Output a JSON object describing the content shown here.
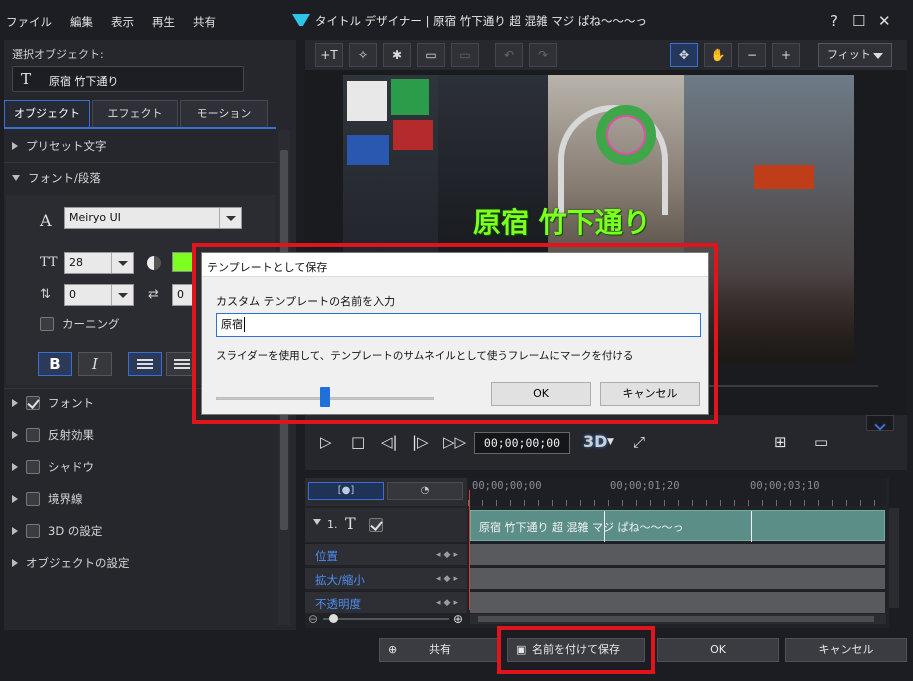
{
  "window": {
    "menu": [
      "ファイル",
      "編集",
      "表示",
      "再生",
      "共有"
    ],
    "title": "タイトル デザイナー | 原宿 竹下通り 超 混雑 マジ ぱね〜〜〜っ",
    "help": "?",
    "maximize": "☐",
    "close": "✕"
  },
  "left_panel": {
    "selected_label": "選択オブジェクト:",
    "selected_icon": "T",
    "selected_value": "原宿 竹下通り",
    "tabs": [
      "オブジェクト",
      "エフェクト",
      "モーション"
    ],
    "sections": {
      "preset": "プリセット文字",
      "font_para": "フォント/段落",
      "font": "フォント",
      "reflection": "反射効果",
      "shadow": "シャドウ",
      "border": "境界線",
      "threed": "3D の設定",
      "object_settings": "オブジェクトの設定"
    },
    "font_name": "Meiryo UI",
    "font_size": "28",
    "line_spacing": "0",
    "letter_spacing": "0",
    "kerning": "カーニング",
    "bold": "B",
    "italic": "I",
    "text_color": "#7dff1f",
    "font_icon": "A",
    "size_icon": "TT",
    "checked_font": true
  },
  "toolbar": {
    "fit": "フィット"
  },
  "preview": {
    "overlay_text": "原宿 竹下通り",
    "timecode": "00;00;00;00",
    "three_d": "3D"
  },
  "timeline": {
    "ruler": [
      "00;00;00;00",
      "00;00;01;20",
      "00;00;03;10"
    ],
    "track_number": "1.",
    "track_icon": "T",
    "clip_label": "原宿 竹下通り 超 混雑 マジ ぱね〜〜〜っ",
    "rows": [
      "位置",
      "拡大/縮小",
      "不透明度"
    ]
  },
  "dialog": {
    "title": "テンプレートとして保存",
    "prompt": "カスタム テンプレートの名前を入力",
    "input_value": "原宿",
    "hint": "スライダーを使用して、テンプレートのサムネイルとして使うフレームにマークを付ける",
    "slider_fraction": 0.5,
    "ok": "OK",
    "cancel": "キャンセル"
  },
  "bottom_bar": {
    "share": "共有",
    "save_as": "名前を付けて保存",
    "ok": "OK",
    "cancel": "キャンセル"
  },
  "colors": {
    "accent": "#3b6fd6",
    "highlight_box": "#e0141c",
    "clip": "#5b8e86"
  }
}
